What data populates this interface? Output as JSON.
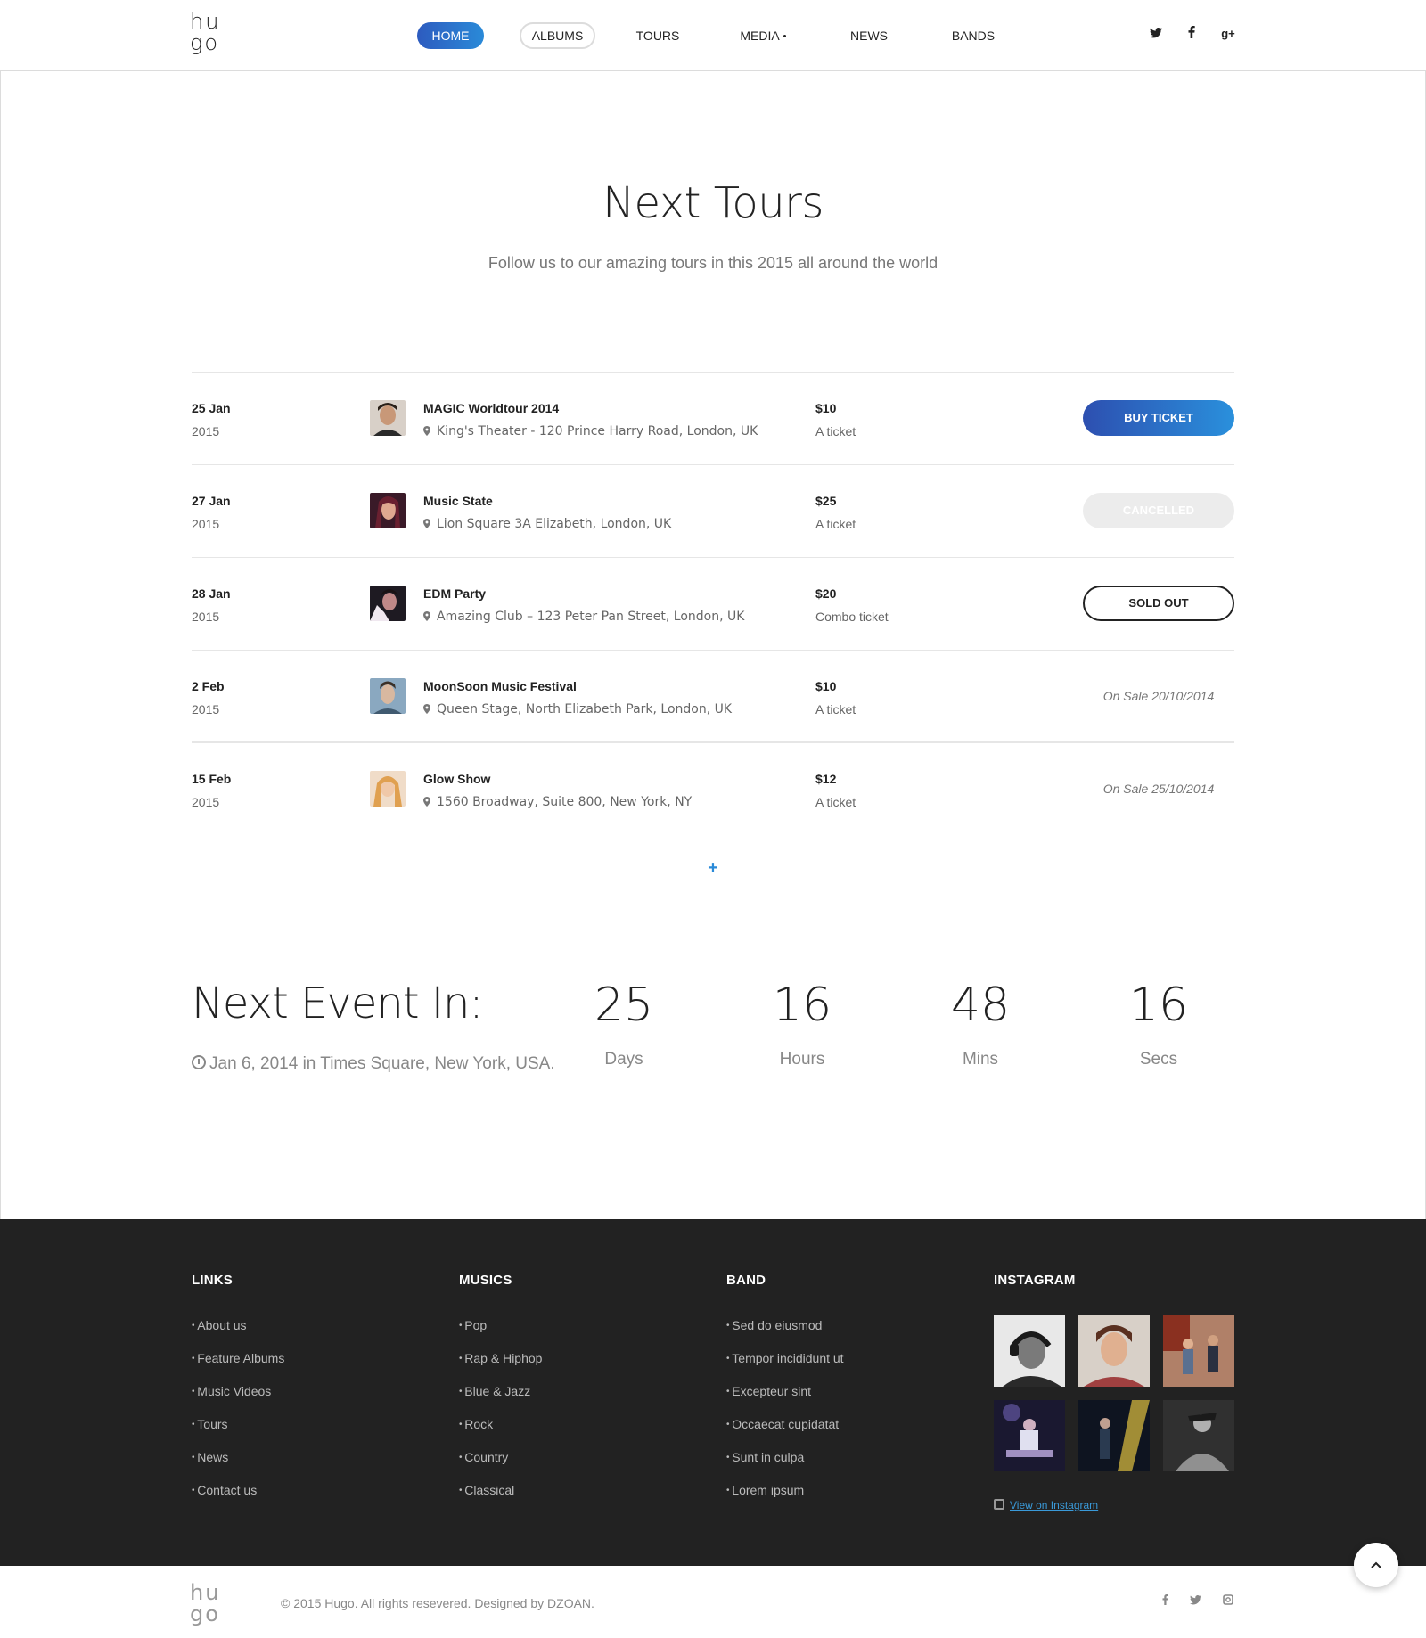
{
  "brand": {
    "logo_top": "hu",
    "logo_bottom": "go"
  },
  "nav": [
    {
      "label": "HOME",
      "style": "active"
    },
    {
      "label": "ALBUMS",
      "style": "outlined"
    },
    {
      "label": "TOURS",
      "style": "plain"
    },
    {
      "label": "MEDIA",
      "style": "dot"
    },
    {
      "label": "NEWS",
      "style": "plain"
    },
    {
      "label": "BANDS",
      "style": "plain"
    }
  ],
  "header_social": [
    {
      "icon": "twitter-icon",
      "glyph": "t"
    },
    {
      "icon": "facebook-icon",
      "glyph": "f"
    },
    {
      "icon": "google-plus-icon",
      "glyph": "g+"
    }
  ],
  "section": {
    "title": "Next Tours",
    "subtitle": "Follow us to our amazing tours in this 2015 all around the world"
  },
  "tours": [
    {
      "day": "25 Jan",
      "year": "2015",
      "name": "MAGIC Worldtour 2014",
      "place": "King's Theater - 120 Prince Harry Road, London, UK",
      "price": "$10",
      "ptype": "A ticket",
      "action": "BUY TICKET",
      "action_type": "buy",
      "thumb_color": "#5a4a3c"
    },
    {
      "day": "27 Jan",
      "year": "2015",
      "name": "Music State",
      "place": "Lion Square 3A Elizabeth, London, UK",
      "price": "$25",
      "ptype": "A ticket",
      "action": "CANCELLED",
      "action_type": "cancel",
      "thumb_color": "#7a3040"
    },
    {
      "day": "28 Jan",
      "year": "2015",
      "name": "EDM Party",
      "place": "Amazing Club – 123 Peter Pan Street, London, UK",
      "price": "$20",
      "ptype": "Combo ticket",
      "action": "SOLD OUT",
      "action_type": "sold",
      "thumb_color": "#3c3440"
    },
    {
      "day": "2 Feb",
      "year": "2015",
      "name": "MoonSoon Music Festival",
      "place": "Queen Stage, North Elizabeth Park, London, UK",
      "price": "$10",
      "ptype": "A ticket",
      "action": "On Sale 20/10/2014",
      "action_type": "onsale",
      "thumb_color": "#6a8aa0"
    },
    {
      "day": "15 Feb",
      "year": "2015",
      "name": "Glow Show",
      "place": "1560 Broadway, Suite 800, New York, NY",
      "price": "$12",
      "ptype": "A ticket",
      "action": "On Sale 25/10/2014",
      "action_type": "onsale",
      "thumb_color": "#d8a070"
    }
  ],
  "more_symbol": "+",
  "event": {
    "title": "Next Event In:",
    "desc": "Jan 6, 2014 in Times Square, New York, USA.",
    "countdown": [
      {
        "value": "25",
        "label": "Days"
      },
      {
        "value": "16",
        "label": "Hours"
      },
      {
        "value": "48",
        "label": "Mins"
      },
      {
        "value": "16",
        "label": "Secs"
      }
    ]
  },
  "footer": {
    "links": {
      "heading": "LINKS",
      "items": [
        "About us",
        "Feature Albums",
        "Music Videos",
        "Tours",
        "News",
        "Contact us"
      ]
    },
    "musics": {
      "heading": "MUSICS",
      "items": [
        "Pop",
        "Rap & Hiphop",
        "Blue & Jazz",
        "Rock",
        "Country",
        "Classical"
      ]
    },
    "band": {
      "heading": "BAND",
      "items": [
        "Sed do eiusmod",
        "Tempor incididunt ut",
        "Excepteur sint",
        "Occaecat cupidatat",
        "Sunt in culpa",
        "Lorem ipsum"
      ]
    },
    "instagram": {
      "heading": "INSTAGRAM",
      "link": "View on Instagram",
      "photos": [
        "#9a9a9a",
        "#b07060",
        "#8a6a58",
        "#4a4a6a",
        "#1a2030",
        "#707070"
      ]
    }
  },
  "bottom": {
    "copyright": "© 2015 Hugo. All rights resevered. Designed by DZOAN.",
    "social": [
      {
        "icon": "facebook-icon",
        "glyph": "f"
      },
      {
        "icon": "twitter-icon",
        "glyph": "t"
      },
      {
        "icon": "instagram-icon",
        "glyph": "◘"
      }
    ]
  },
  "accent": "#2a8ad8"
}
